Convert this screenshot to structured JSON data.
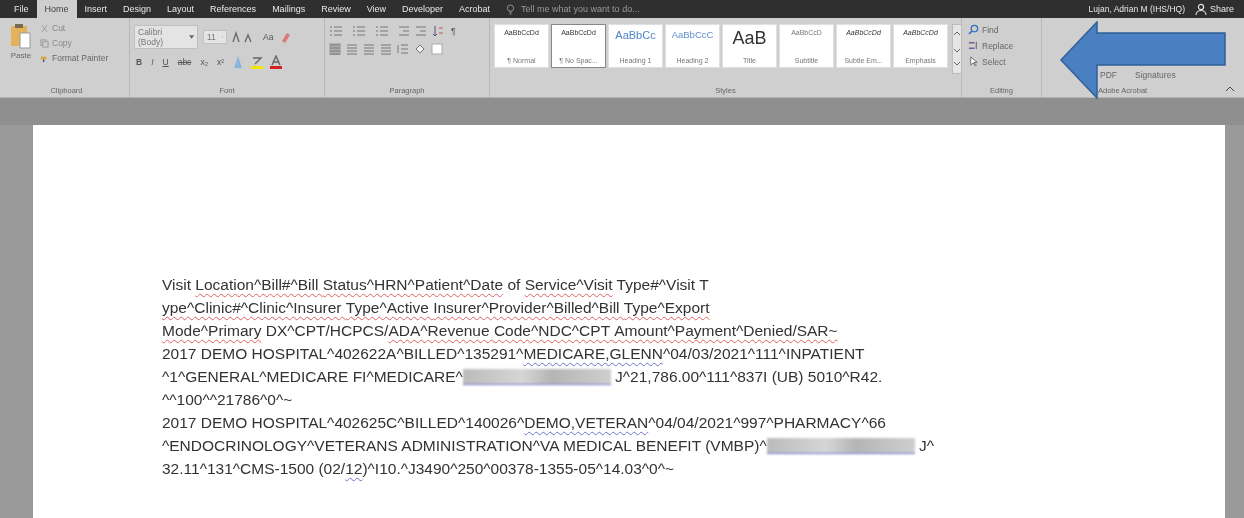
{
  "tabs": [
    {
      "label": "File",
      "selected": false
    },
    {
      "label": "Home",
      "selected": true
    },
    {
      "label": "Insert",
      "selected": false
    },
    {
      "label": "Design",
      "selected": false
    },
    {
      "label": "Layout",
      "selected": false
    },
    {
      "label": "References",
      "selected": false
    },
    {
      "label": "Mailings",
      "selected": false
    },
    {
      "label": "Review",
      "selected": false
    },
    {
      "label": "View",
      "selected": false
    },
    {
      "label": "Developer",
      "selected": false
    },
    {
      "label": "Acrobat",
      "selected": false
    }
  ],
  "tell_me": {
    "placeholder": "Tell me what you want to do..."
  },
  "user": "Lujan, Adrian M (IHS/HQ)",
  "share": "Share",
  "clipboard": {
    "paste": "Paste",
    "cut": "Cut",
    "copy": "Copy",
    "format_painter": "Format Painter",
    "label": "Clipboard"
  },
  "font": {
    "name": "Calibri (Body)",
    "size": "11",
    "case": "Aa",
    "buttons": [
      "B",
      "I",
      "U",
      "abc",
      "x₂",
      "x²"
    ],
    "label": "Font"
  },
  "paragraph": {
    "pilcrow": "¶",
    "label": "Paragraph"
  },
  "styles": {
    "label": "Styles",
    "items": [
      {
        "preview": "AaBbCcDd",
        "name": "¶ Normal",
        "kind": "body",
        "selected": false
      },
      {
        "preview": "AaBbCcDd",
        "name": "¶ No Spac...",
        "kind": "body",
        "selected": true
      },
      {
        "preview": "AaBbCc",
        "name": "Heading 1",
        "kind": "heading1",
        "selected": false
      },
      {
        "preview": "AaBbCcC",
        "name": "Heading 2",
        "kind": "heading2",
        "selected": false
      },
      {
        "preview": "AaB",
        "name": "Title",
        "kind": "title",
        "selected": false
      },
      {
        "preview": "AaBbCcD",
        "name": "Subtitle",
        "kind": "subtitle",
        "selected": false
      },
      {
        "preview": "AaBbCcDd",
        "name": "Subtle Em...",
        "kind": "italic",
        "selected": false
      },
      {
        "preview": "AaBbCcDd",
        "name": "Emphasis",
        "kind": "italic",
        "selected": false
      }
    ]
  },
  "editing": {
    "find": "Find",
    "replace": "Replace",
    "select": "Select",
    "label": "Editing"
  },
  "acrobat": {
    "items": [
      "PDF",
      "Signatures"
    ],
    "label": "Adobe Acrobat"
  },
  "document": {
    "lines": [
      [
        {
          "text": "Visit "
        },
        {
          "text": "Location^Bill#^Bill ",
          "misspelled": true
        },
        {
          "text": "Status^HRN^Patient^Date",
          "misspelled": true
        },
        {
          "text": " of "
        },
        {
          "text": "Service^Visit",
          "misspelled": true
        },
        {
          "text": " Type#^Visit T"
        }
      ],
      [
        {
          "text": "ype^Clinic#^Clinic^Insurer ",
          "misspelled": true
        },
        {
          "text": "Type^Active ",
          "misspelled": true
        },
        {
          "text": "Insurer^Provider^Billed^Bill ",
          "misspelled": true
        },
        {
          "text": "Type^Export",
          "misspelled": true
        }
      ],
      [
        {
          "text": "Mode^Primary",
          "misspelled": true
        },
        {
          "text": " DX^CPT/HCPCS/"
        },
        {
          "text": "ADA^Revenue ",
          "misspelled": true
        },
        {
          "text": "Code^NDC^CPT ",
          "misspelled": true
        },
        {
          "text": "Amount^Payment^Denied/SAR~",
          "misspelled": true
        }
      ],
      [
        {
          "text": "2017 DEMO HOSPITAL^402622A^BILLED^135291^"
        },
        {
          "text": "MEDICARE,GLENN",
          "grammar_flag": true
        },
        {
          "text": "^04/03/2021^111^INPATIENT"
        }
      ],
      [
        {
          "text": "^1^GENERAL^MEDICARE FI^MEDICARE^"
        },
        {
          "kind": "redacted"
        },
        {
          "text": " J^21,786.00^111^837I (UB) 5010^R42."
        }
      ],
      [
        {
          "text": "^^100^^21786^0^~"
        }
      ],
      [
        {
          "text": "2017 DEMO HOSPITAL^402625C^BILLED^140026^"
        },
        {
          "text": "DEMO,VETERAN",
          "grammar_flag": true
        },
        {
          "text": "^04/04/2021^997^PHARMACY^66"
        }
      ],
      [
        {
          "text": "^ENDOCRINOLOGY^VETERANS ADMINISTRATION^VA MEDICAL BENEFIT (VMBP)^"
        },
        {
          "kind": "redacted"
        },
        {
          "text": " J^"
        }
      ],
      [
        {
          "text": "32.11^131^CMS-1500 (02/"
        },
        {
          "text": "12",
          "grammar_flag": true
        },
        {
          "text": ")^I10.^J3490^250^00378-1355-05^14.03^0^~"
        }
      ]
    ]
  }
}
